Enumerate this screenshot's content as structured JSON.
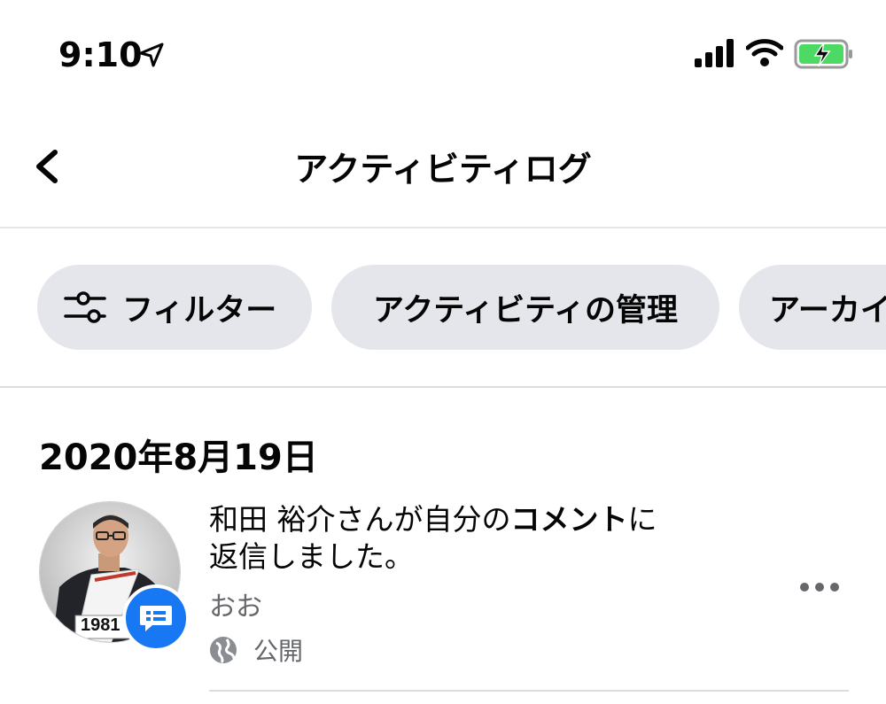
{
  "status_bar": {
    "time": "9:10",
    "icons": [
      "location-arrow-icon",
      "cellular-signal-icon",
      "wifi-icon",
      "battery-charging-icon"
    ]
  },
  "header": {
    "back_icon": "chevron-left-icon",
    "title": "アクティビティログ"
  },
  "chips": {
    "filter": {
      "icon": "filter-sliders-icon",
      "label": "フィルター"
    },
    "manage": {
      "label": "アクティビティの管理"
    },
    "archive": {
      "label": "アーカイ"
    }
  },
  "date_heading": "2020年8月19日",
  "activity": {
    "text_part1": "和田 裕介さんが自分の",
    "text_bold": "コメント",
    "text_part2": "に",
    "text_line2": "返信しました。",
    "snippet": "おお",
    "privacy": "公開",
    "avatar_number": "1981",
    "badge_icon": "comment-icon",
    "privacy_icon": "globe-icon",
    "more_icon": "more-horizontal-icon"
  },
  "colors": {
    "chip_bg": "#e4e6eb",
    "badge_blue": "#1877f2",
    "secondary_text": "#65676b",
    "battery_green": "#4cd964"
  }
}
